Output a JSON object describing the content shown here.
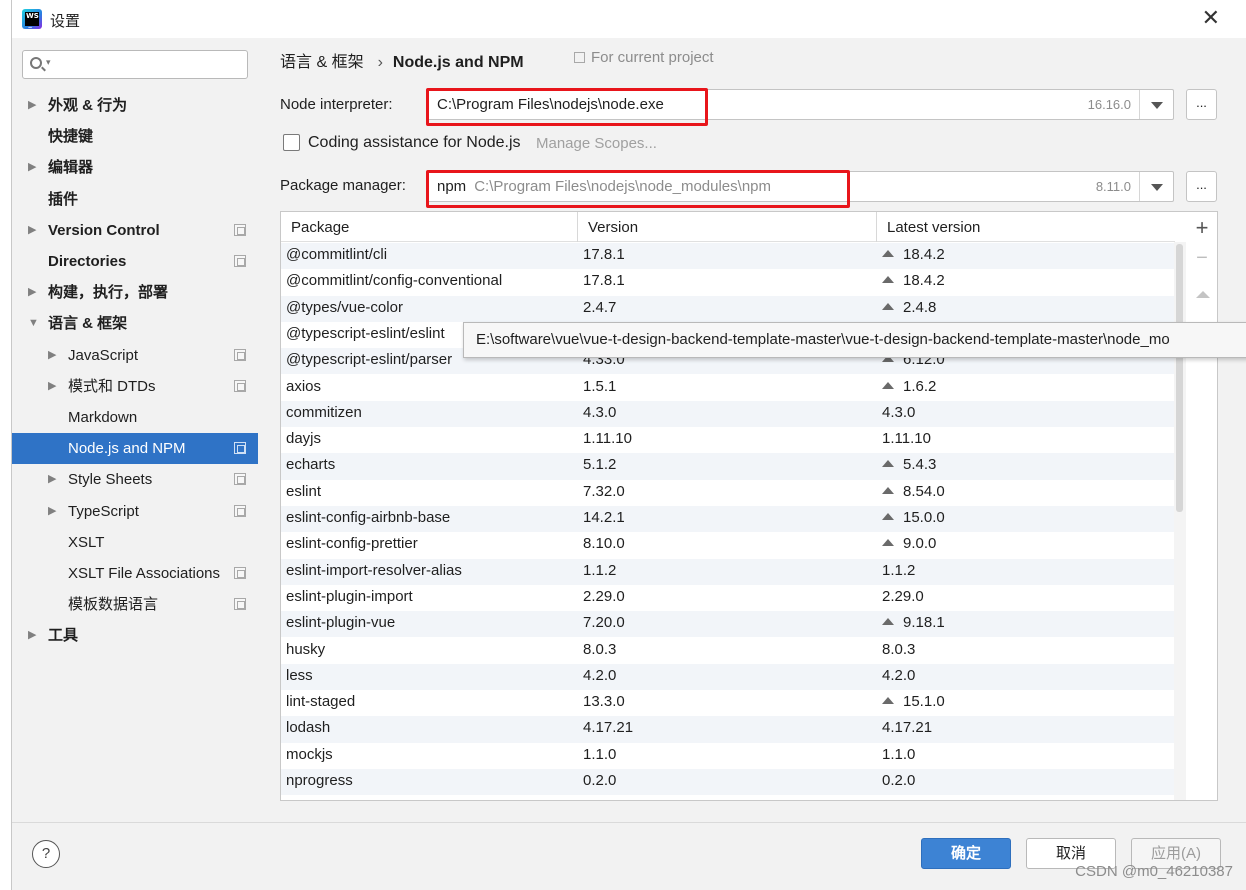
{
  "window": {
    "title": "设置"
  },
  "sidebar": {
    "search_placeholder": "",
    "items": [
      {
        "label": "外观 & 行为",
        "arrow": "▶",
        "bold": true,
        "indent": 0,
        "proj": false
      },
      {
        "label": "快捷键",
        "arrow": "",
        "bold": true,
        "indent": 0,
        "proj": false
      },
      {
        "label": "编辑器",
        "arrow": "▶",
        "bold": true,
        "indent": 0,
        "proj": false
      },
      {
        "label": "插件",
        "arrow": "",
        "bold": true,
        "indent": 0,
        "proj": false
      },
      {
        "label": "Version Control",
        "arrow": "▶",
        "bold": true,
        "indent": 0,
        "proj": true
      },
      {
        "label": "Directories",
        "arrow": "",
        "bold": true,
        "indent": 0,
        "proj": true
      },
      {
        "label": "构建，执行，部署",
        "arrow": "▶",
        "bold": true,
        "indent": 0,
        "proj": false
      },
      {
        "label": "语言 & 框架",
        "arrow": "▼",
        "bold": true,
        "indent": 0,
        "proj": false
      },
      {
        "label": "JavaScript",
        "arrow": "▶",
        "bold": false,
        "indent": 1,
        "proj": true
      },
      {
        "label": "模式和 DTDs",
        "arrow": "▶",
        "bold": false,
        "indent": 1,
        "proj": true
      },
      {
        "label": "Markdown",
        "arrow": "",
        "bold": false,
        "indent": 1,
        "proj": false
      },
      {
        "label": "Node.js and NPM",
        "arrow": "",
        "bold": false,
        "indent": 1,
        "proj": true,
        "selected": true
      },
      {
        "label": "Style Sheets",
        "arrow": "▶",
        "bold": false,
        "indent": 1,
        "proj": true
      },
      {
        "label": "TypeScript",
        "arrow": "▶",
        "bold": false,
        "indent": 1,
        "proj": true
      },
      {
        "label": "XSLT",
        "arrow": "",
        "bold": false,
        "indent": 1,
        "proj": false
      },
      {
        "label": "XSLT File Associations",
        "arrow": "",
        "bold": false,
        "indent": 1,
        "proj": true
      },
      {
        "label": "模板数据语言",
        "arrow": "",
        "bold": false,
        "indent": 1,
        "proj": true
      },
      {
        "label": "工具",
        "arrow": "▶",
        "bold": true,
        "indent": 0,
        "proj": false
      }
    ]
  },
  "breadcrumb": {
    "parent": "语言 & 框架",
    "separator": "›",
    "current": "Node.js and NPM",
    "scope": "For current project"
  },
  "interpreter": {
    "label": "Node interpreter:",
    "value": "C:\\Program Files\\nodejs\\node.exe",
    "version": "16.16.0",
    "more": "..."
  },
  "coding": {
    "label": "Coding assistance for Node.js",
    "checked": false,
    "manage": "Manage Scopes..."
  },
  "package_manager": {
    "label": "Package manager:",
    "name": "npm",
    "path": "C:\\Program Files\\nodejs\\node_modules\\npm",
    "version": "8.11.0",
    "more": "..."
  },
  "table": {
    "columns": [
      "Package",
      "Version",
      "Latest version"
    ],
    "rows": [
      {
        "package": "@commitlint/cli",
        "version": "17.8.1",
        "latest": "18.4.2",
        "upgrade": true
      },
      {
        "package": "@commitlint/config-conventional",
        "version": "17.8.1",
        "latest": "18.4.2",
        "upgrade": true
      },
      {
        "package": "@types/vue-color",
        "version": "2.4.7",
        "latest": "2.4.8",
        "upgrade": true
      },
      {
        "package": "@typescript-eslint/eslint",
        "version": "",
        "latest": "",
        "upgrade": false
      },
      {
        "package": "@typescript-eslint/parser",
        "version": "4.33.0",
        "latest": "6.12.0",
        "upgrade": true
      },
      {
        "package": "axios",
        "version": "1.5.1",
        "latest": "1.6.2",
        "upgrade": true
      },
      {
        "package": "commitizen",
        "version": "4.3.0",
        "latest": "4.3.0",
        "upgrade": false
      },
      {
        "package": "dayjs",
        "version": "1.11.10",
        "latest": "1.11.10",
        "upgrade": false
      },
      {
        "package": "echarts",
        "version": "5.1.2",
        "latest": "5.4.3",
        "upgrade": true
      },
      {
        "package": "eslint",
        "version": "7.32.0",
        "latest": "8.54.0",
        "upgrade": true
      },
      {
        "package": "eslint-config-airbnb-base",
        "version": "14.2.1",
        "latest": "15.0.0",
        "upgrade": true
      },
      {
        "package": "eslint-config-prettier",
        "version": "8.10.0",
        "latest": "9.0.0",
        "upgrade": true
      },
      {
        "package": "eslint-import-resolver-alias",
        "version": "1.1.2",
        "latest": "1.1.2",
        "upgrade": false
      },
      {
        "package": "eslint-plugin-import",
        "version": "2.29.0",
        "latest": "2.29.0",
        "upgrade": false
      },
      {
        "package": "eslint-plugin-vue",
        "version": "7.20.0",
        "latest": "9.18.1",
        "upgrade": true
      },
      {
        "package": "husky",
        "version": "8.0.3",
        "latest": "8.0.3",
        "upgrade": false
      },
      {
        "package": "less",
        "version": "4.2.0",
        "latest": "4.2.0",
        "upgrade": false
      },
      {
        "package": "lint-staged",
        "version": "13.3.0",
        "latest": "15.1.0",
        "upgrade": true
      },
      {
        "package": "lodash",
        "version": "4.17.21",
        "latest": "4.17.21",
        "upgrade": false
      },
      {
        "package": "mockjs",
        "version": "1.1.0",
        "latest": "1.1.0",
        "upgrade": false
      },
      {
        "package": "nprogress",
        "version": "0.2.0",
        "latest": "0.2.0",
        "upgrade": false
      }
    ]
  },
  "toolbar": {
    "add": "+",
    "remove": "−"
  },
  "tooltip": "E:\\software\\vue\\vue-t-design-backend-template-master\\vue-t-design-backend-template-master\\node_mo",
  "footer": {
    "help": "?",
    "ok": "确定",
    "cancel": "取消",
    "apply": "应用(A)",
    "watermark": "CSDN @m0_46210387"
  },
  "colors": {
    "selection": "#2f73c6",
    "highlight_box": "#e8151b",
    "primary_button": "#3d83d4"
  }
}
